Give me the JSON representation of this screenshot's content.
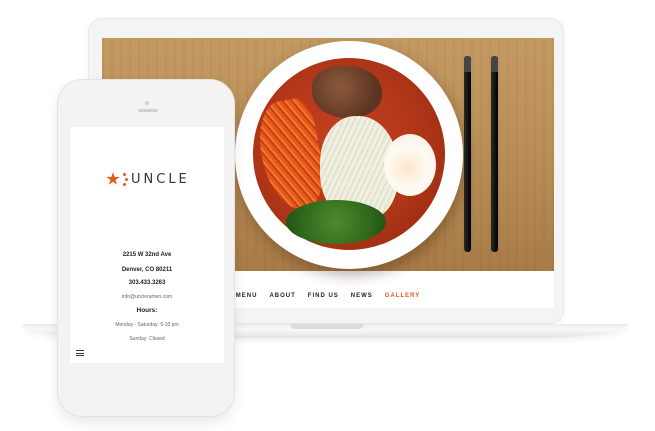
{
  "laptop": {
    "nav": [
      "MENU",
      "ABOUT",
      "FIND US",
      "NEWS",
      "GALLERY"
    ],
    "active_nav": "GALLERY"
  },
  "phone": {
    "logo_text": "UNCLE",
    "address_line1": "2215 W 32nd Ave",
    "address_line2": "Denver, CO 80211",
    "phone": "303.433.3263",
    "email": "info@uncleramen.com",
    "hours_title": "Hours:",
    "hours_weekday": "Monday - Saturday: 5-10 pm",
    "hours_sunday": "Sunday: Closed"
  },
  "colors": {
    "accent": "#e35a1e",
    "text": "#222222"
  },
  "icons": [
    "star-logo-icon",
    "hamburger-menu-icon"
  ]
}
